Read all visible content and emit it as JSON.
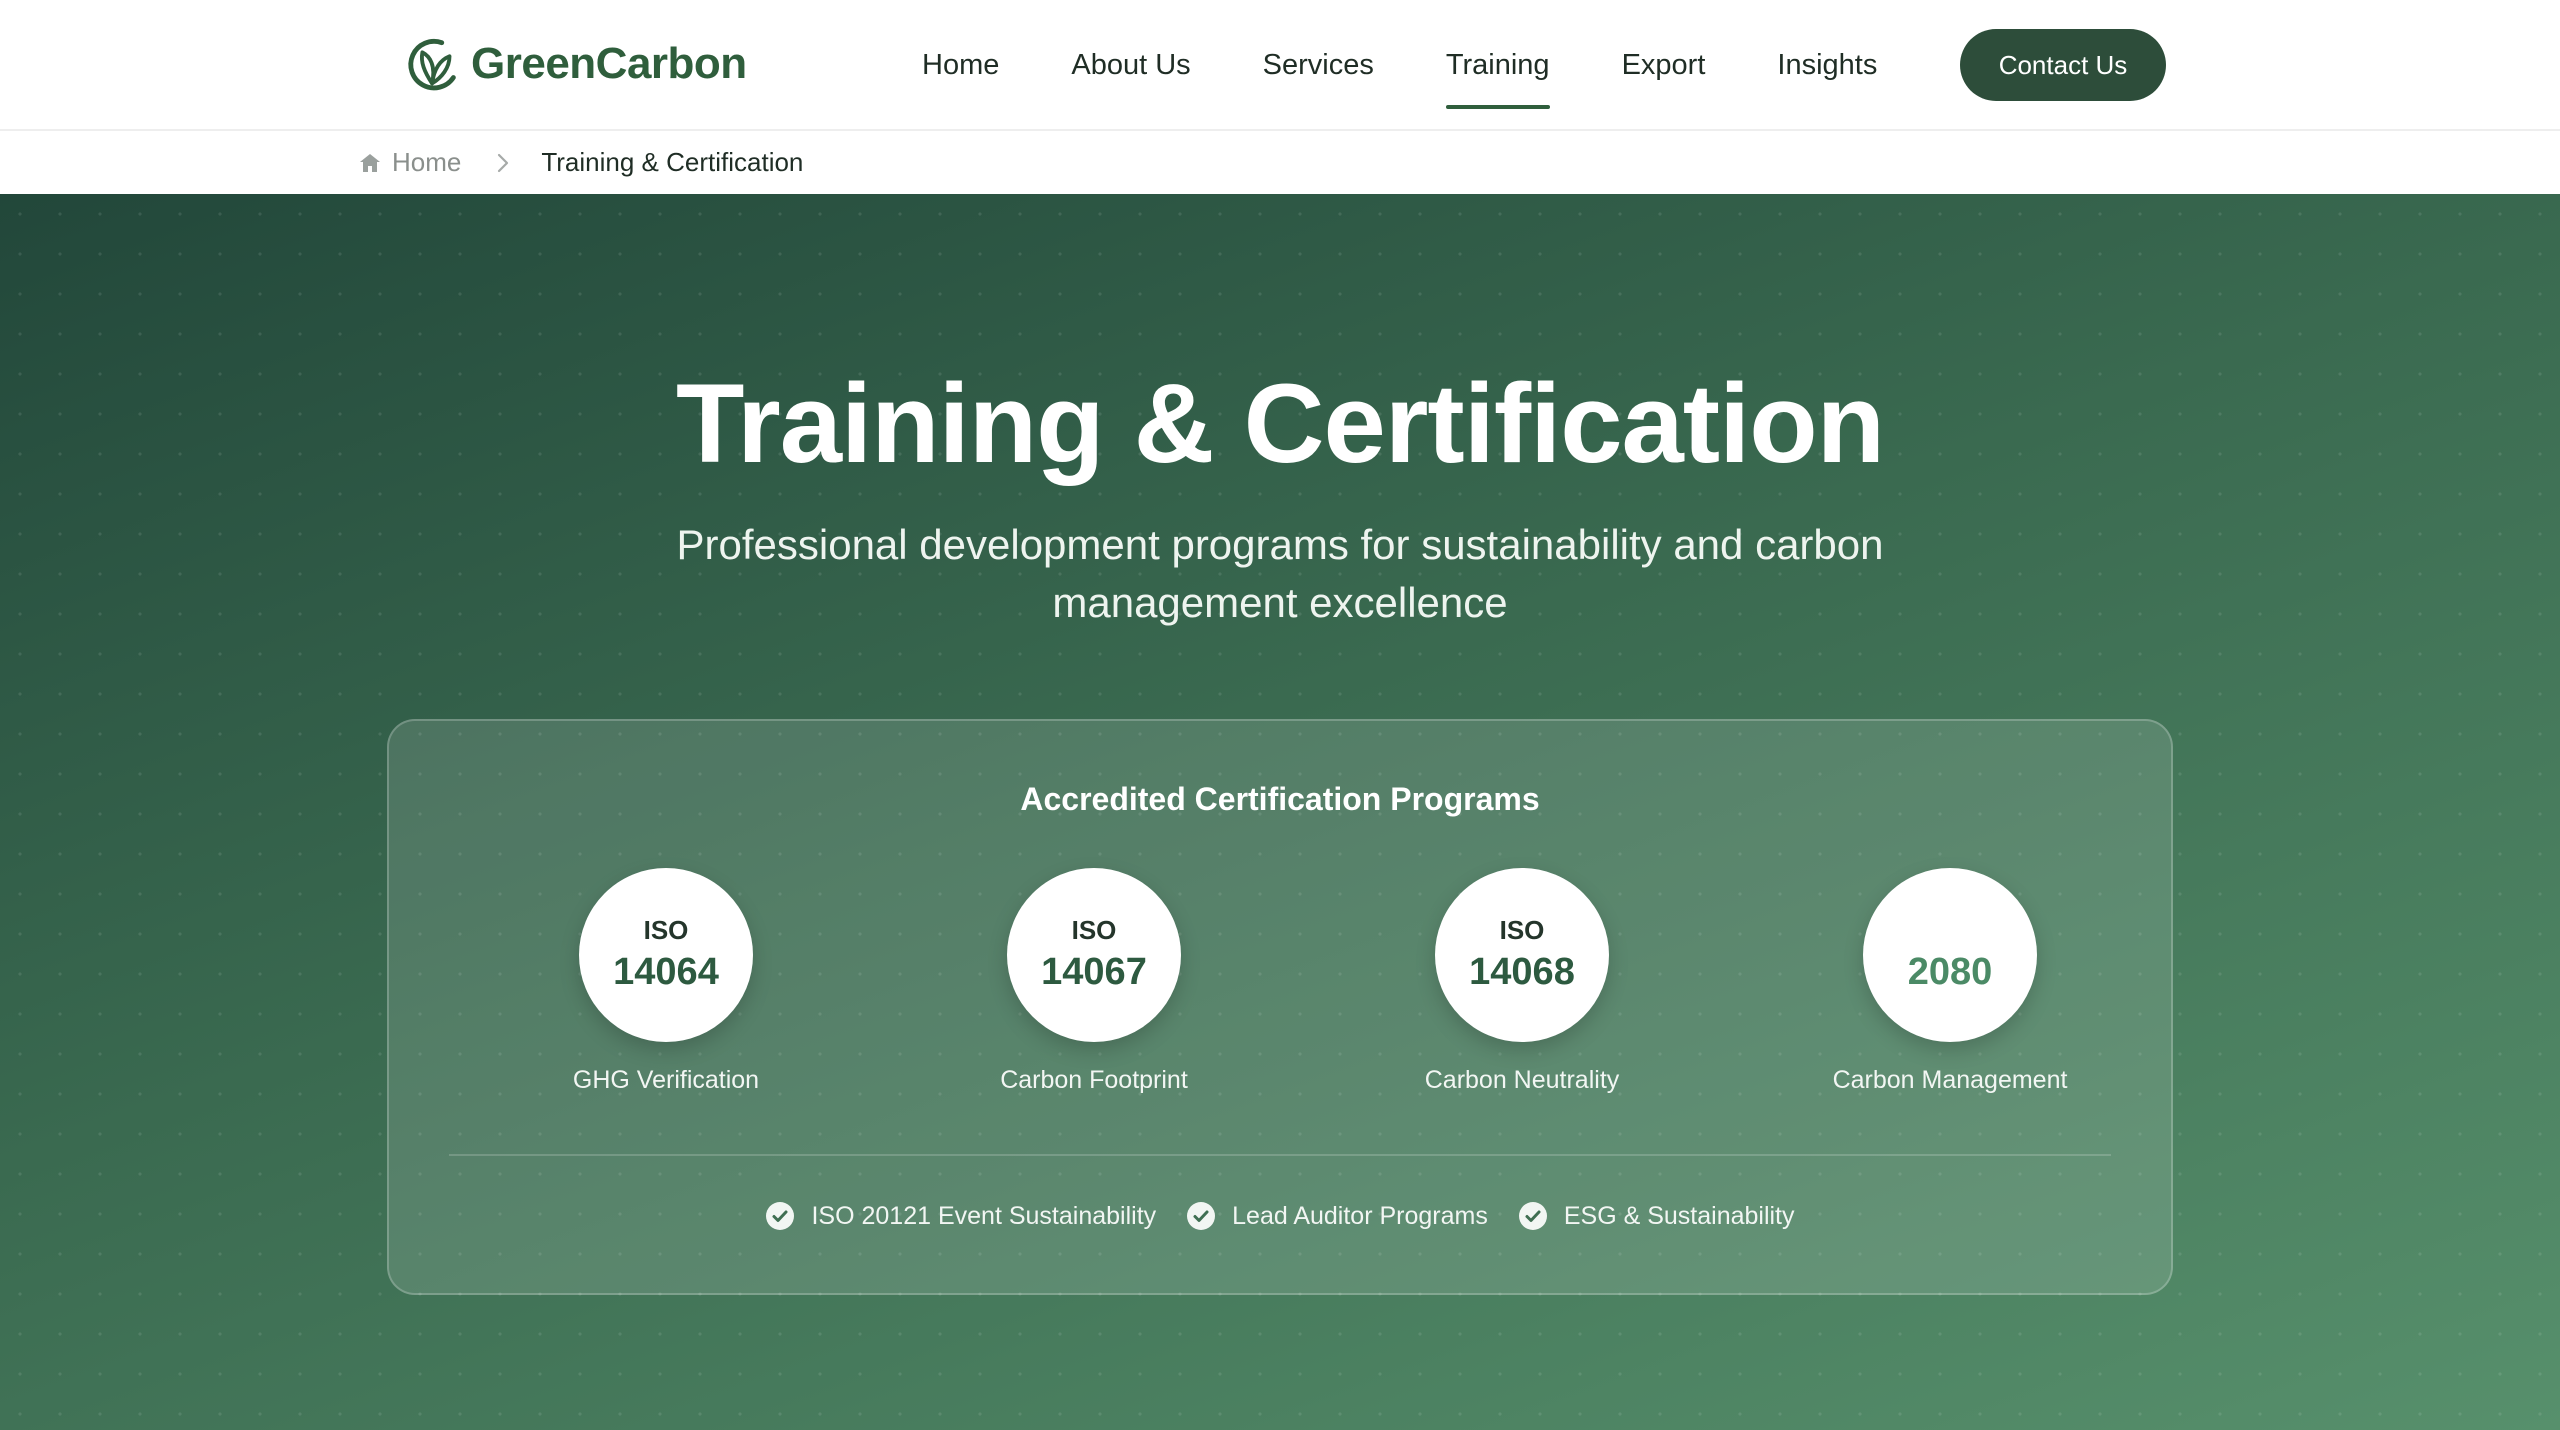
{
  "brand": {
    "name": "GreenCarbon",
    "logo_icon": "leaf-c-logo"
  },
  "nav": {
    "items": [
      {
        "label": "Home",
        "active": false
      },
      {
        "label": "About Us",
        "active": false
      },
      {
        "label": "Services",
        "active": false
      },
      {
        "label": "Training",
        "active": true
      },
      {
        "label": "Export",
        "active": false
      },
      {
        "label": "Insights",
        "active": false
      }
    ],
    "cta_label": "Contact Us"
  },
  "breadcrumb": {
    "home_label": "Home",
    "home_icon": "home-icon",
    "separator_icon": "chevron-right-icon",
    "current": "Training & Certification"
  },
  "hero": {
    "title": "Training & Certification",
    "subtitle": "Professional development programs for sustainability and carbon management excellence"
  },
  "programs": {
    "heading": "Accredited Certification Programs",
    "items": [
      {
        "prefix": "ISO",
        "number": "14064",
        "label": "GHG Verification"
      },
      {
        "prefix": "ISO",
        "number": "14067",
        "label": "Carbon Footprint"
      },
      {
        "prefix": "ISO",
        "number": "14068",
        "label": "Carbon Neutrality"
      },
      {
        "prefix": "",
        "number": "2080",
        "label": "Carbon Management"
      }
    ],
    "features": [
      {
        "icon": "check-circle-icon",
        "label": "ISO 20121 Event Sustainability"
      },
      {
        "icon": "check-circle-icon",
        "label": "Lead Auditor Programs"
      },
      {
        "icon": "check-circle-icon",
        "label": "ESG & Sustainability"
      }
    ]
  },
  "colors": {
    "brand_green": "#2f5e3c",
    "cta_bg": "#2d4d3a",
    "hero_gradient_start": "#22473a",
    "hero_gradient_end": "#57906c"
  }
}
